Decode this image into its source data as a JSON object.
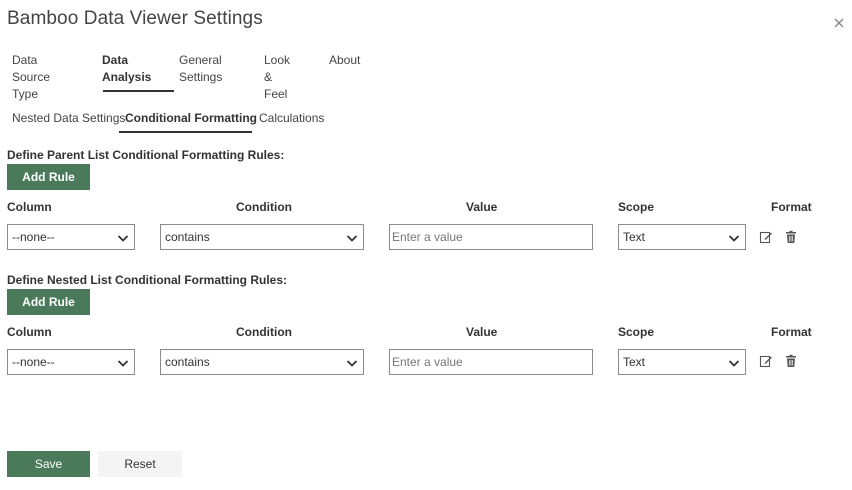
{
  "dialog": {
    "title": "Bamboo Data Viewer Settings"
  },
  "main_tabs": [
    {
      "label": "Data Source\nType"
    },
    {
      "label": "Data\nAnalysis"
    },
    {
      "label": "General\nSettings"
    },
    {
      "label": "Look &\nFeel"
    },
    {
      "label": "About"
    }
  ],
  "sub_tabs": [
    {
      "label": "Nested Data Settings"
    },
    {
      "label": "Conditional Formatting"
    },
    {
      "label": "Calculations"
    }
  ],
  "parent_section": {
    "heading": "Define Parent List Conditional Formatting Rules:",
    "add_rule_label": "Add Rule",
    "headers": {
      "column": "Column",
      "condition": "Condition",
      "value": "Value",
      "scope": "Scope",
      "format": "Format"
    },
    "row": {
      "column": "--none--",
      "condition": "contains",
      "value_placeholder": "Enter a value",
      "scope": "Text"
    }
  },
  "nested_section": {
    "heading": "Define Nested List Conditional Formatting Rules:",
    "add_rule_label": "Add Rule",
    "headers": {
      "column": "Column",
      "condition": "Condition",
      "value": "Value",
      "scope": "Scope",
      "format": "Format"
    },
    "row": {
      "column": "--none--",
      "condition": "contains",
      "value_placeholder": "Enter a value",
      "scope": "Text"
    }
  },
  "footer": {
    "save_label": "Save",
    "reset_label": "Reset"
  },
  "colors": {
    "accent_green": "#4a7a59",
    "text": "#333333",
    "border": "#8a8a8a"
  },
  "icons": {
    "close": "close-icon",
    "chevron": "chevron-down-icon",
    "edit": "edit-icon",
    "delete": "trash-icon"
  }
}
